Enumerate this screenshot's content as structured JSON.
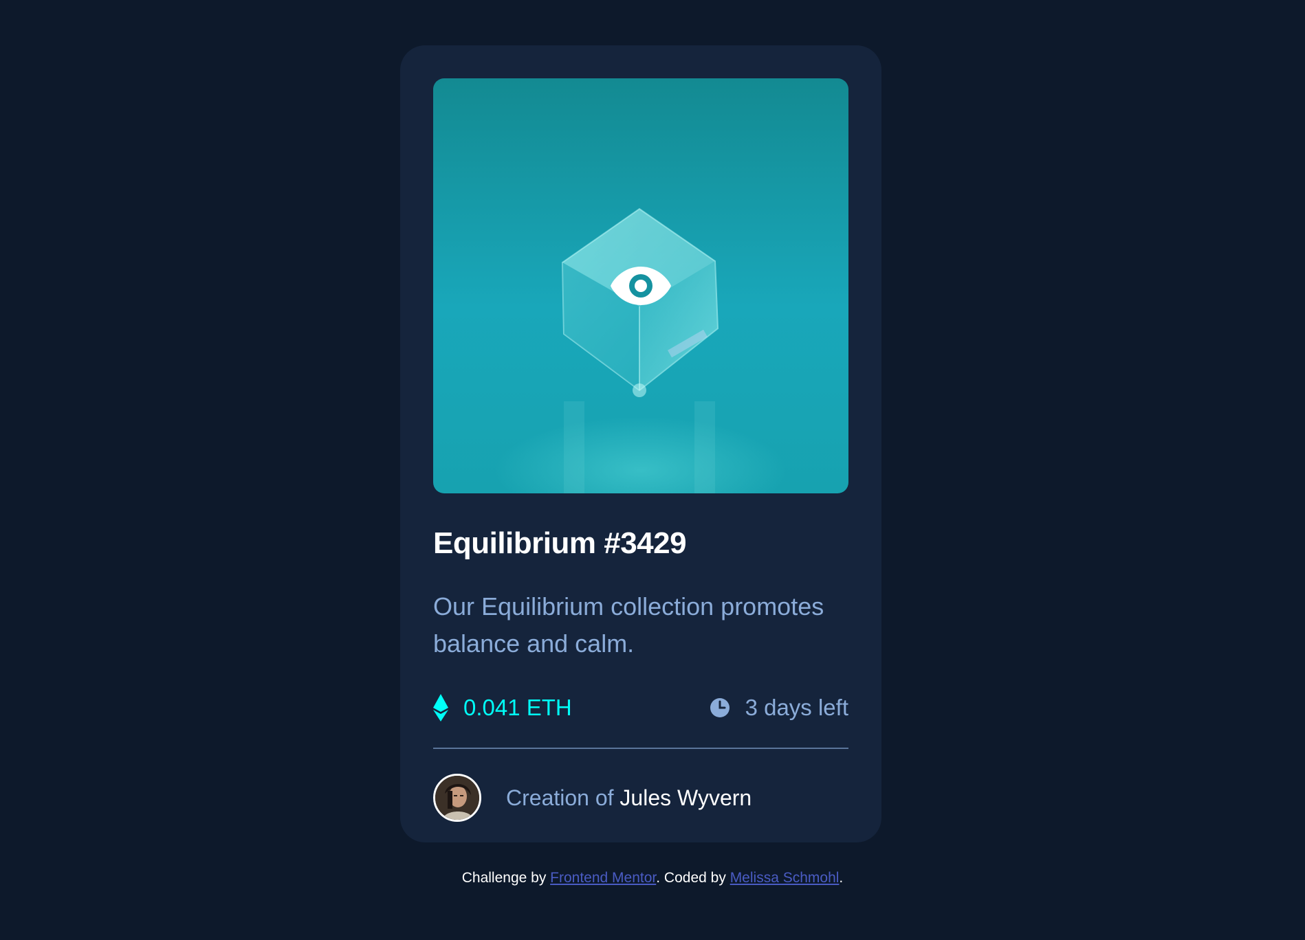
{
  "card": {
    "title": "Equilibrium #3429",
    "description": "Our Equilibrium collection promotes balance and calm.",
    "price": "0.041 ETH",
    "time_left": "3 days left",
    "creator_prefix": "Creation of",
    "creator_name": "Jules Wyvern"
  },
  "footer": {
    "challenge_prefix": "Challenge by",
    "challenge_link": "Frontend Mentor",
    "coded_prefix": ". Coded by",
    "coded_link": "Melissa Schmohl",
    "suffix": "."
  },
  "icons": {
    "eye": "eye-icon",
    "ethereum": "ethereum-icon",
    "clock": "clock-icon"
  },
  "colors": {
    "background": "#0d192b",
    "card": "#15243c",
    "cyan": "#00fff8",
    "soft_blue": "#8bacd9",
    "white": "#ffffff",
    "link": "#4a5cc4"
  }
}
